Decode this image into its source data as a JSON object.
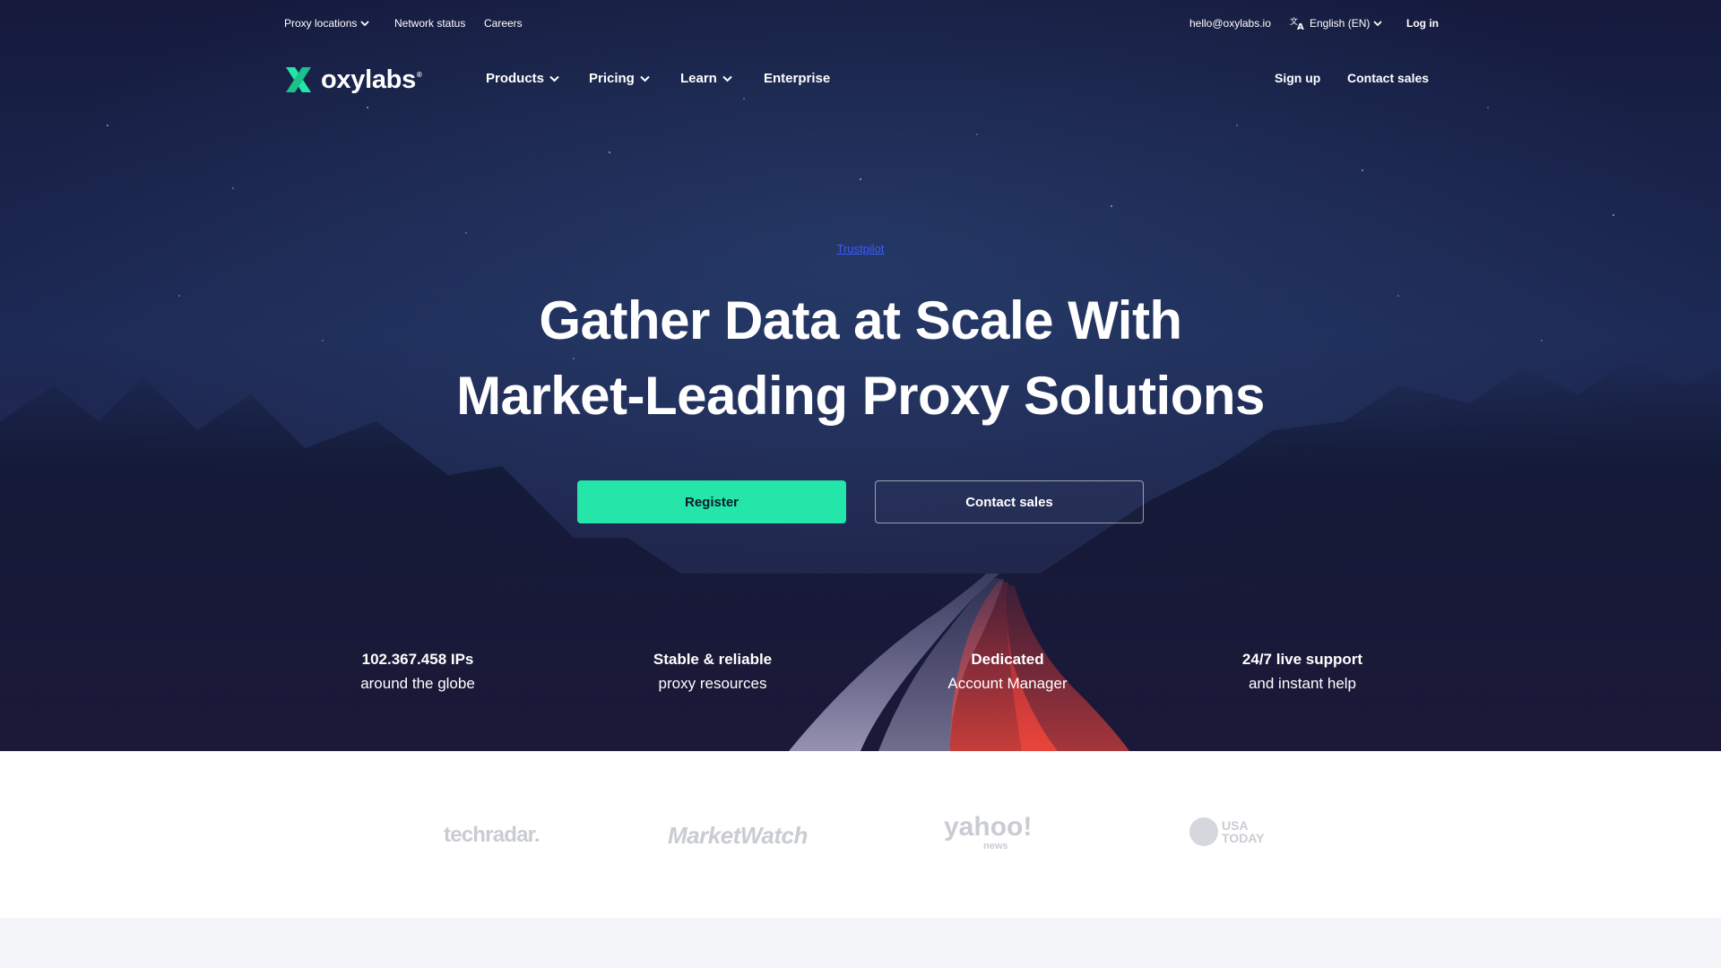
{
  "topbar": {
    "proxy_locations": "Proxy locations",
    "network_status": "Network status",
    "careers": "Careers",
    "email": "hello@oxylabs.io",
    "language": "English (EN)",
    "login": "Log in"
  },
  "nav": {
    "logo_text": "oxylabs",
    "logo_mark": "®",
    "products": "Products",
    "pricing": "Pricing",
    "learn": "Learn",
    "enterprise": "Enterprise",
    "signup": "Sign up",
    "contact_sales": "Contact sales"
  },
  "hero": {
    "trustpilot": "Trustpilot",
    "headline_line1": "Gather Data at Scale With",
    "headline_line2": "Market-Leading Proxy Solutions",
    "register_button": "Register",
    "contact_button": "Contact sales"
  },
  "features": [
    {
      "title": "102.367.458 IPs",
      "subtitle": "around the globe"
    },
    {
      "title": "Stable & reliable",
      "subtitle": "proxy resources"
    },
    {
      "title": "Dedicated",
      "subtitle": "Account Manager"
    },
    {
      "title": "24/7 live support",
      "subtitle": "and instant help"
    }
  ],
  "press": {
    "techradar": "techradar.",
    "marketwatch": "MarketWatch",
    "yahoo": "yahoo!",
    "yahoo_sub": "news",
    "usatoday_1": "USA",
    "usatoday_2": "TODAY"
  },
  "colors": {
    "accent": "#23e6a8",
    "hero_bg": "#1a1a44",
    "press_logo": "#c9ccd2"
  }
}
